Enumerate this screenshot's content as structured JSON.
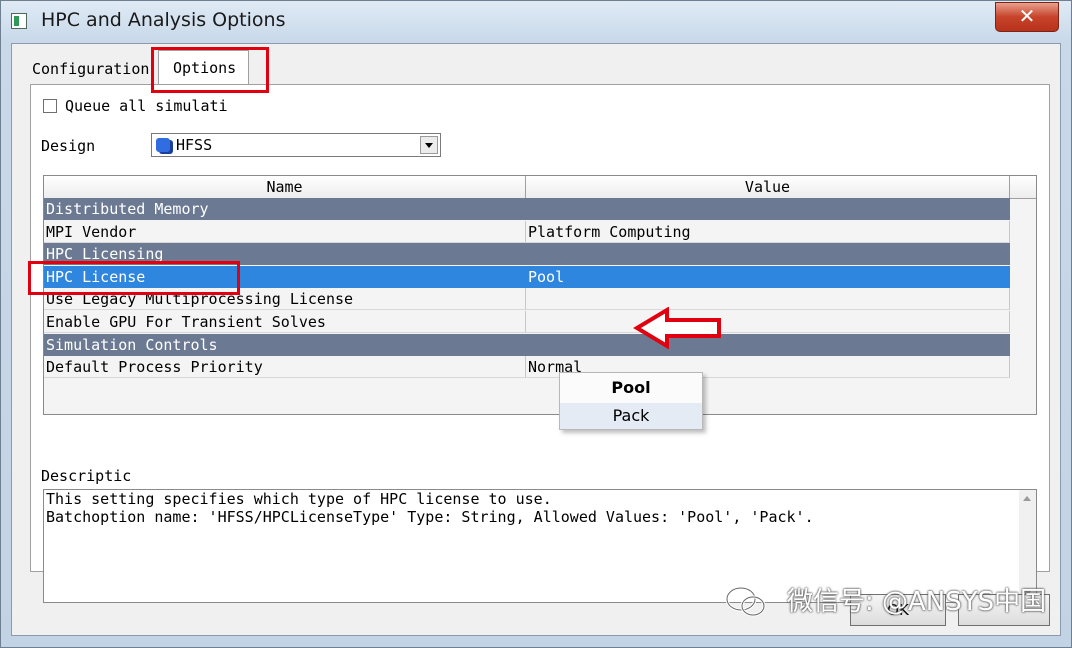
{
  "window": {
    "title": "HPC and Analysis Options",
    "close_glyph": "✕"
  },
  "tabs": [
    {
      "label": "Configuration"
    },
    {
      "label": "Options"
    }
  ],
  "options": {
    "queue_label": "Queue all simulati",
    "queue_checked": false,
    "design_label": "Design",
    "design_value": "HFSS"
  },
  "grid": {
    "headers": [
      "Name",
      "Value"
    ],
    "rows": [
      {
        "name": "Distributed Memory",
        "value": "",
        "kind": "category"
      },
      {
        "name": "MPI Vendor",
        "value": "Platform Computing",
        "kind": "normal"
      },
      {
        "name": "HPC Licensing",
        "value": "",
        "kind": "category"
      },
      {
        "name": "HPC License",
        "value": "Pool",
        "kind": "selected"
      },
      {
        "name": "Use Legacy Multiprocessing License",
        "value": "",
        "kind": "normal"
      },
      {
        "name": "Enable GPU For Transient Solves",
        "value": "",
        "kind": "normal"
      },
      {
        "name": "Simulation Controls",
        "value": "",
        "kind": "category"
      },
      {
        "name": "Default Process Priority",
        "value": "Normal",
        "kind": "normal"
      }
    ]
  },
  "dropdown": {
    "items": [
      "Pool",
      "Pack"
    ],
    "selected": "Pool",
    "highlighted": "Pack"
  },
  "description": {
    "label": "Descriptic",
    "line1": "This setting specifies which type of HPC license to use.",
    "line2": "Batchoption name: 'HFSS/HPCLicenseType' Type: String, Allowed Values: 'Pool', 'Pack'."
  },
  "buttons": {
    "ok": "OK"
  },
  "watermark": "微信号: @ANSYS中国",
  "annotation_color": "#e00010"
}
